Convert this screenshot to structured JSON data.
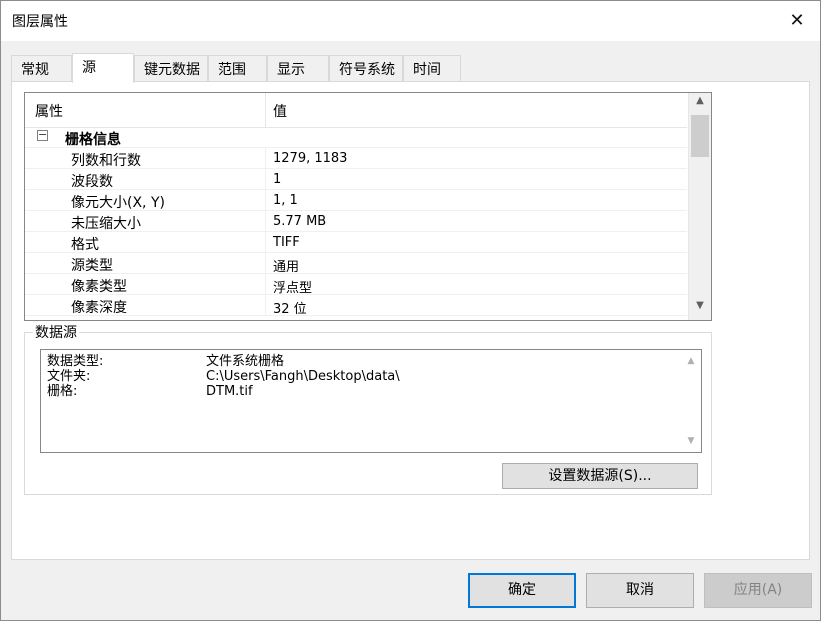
{
  "window": {
    "title": "图层属性",
    "close_symbol": "✕"
  },
  "tabs": [
    {
      "label": "常规",
      "active": false
    },
    {
      "label": "源",
      "active": true
    },
    {
      "label": "键元数据",
      "active": false
    },
    {
      "label": "范围",
      "active": false
    },
    {
      "label": "显示",
      "active": false
    },
    {
      "label": "符号系统",
      "active": false
    },
    {
      "label": "时间",
      "active": false
    }
  ],
  "property_grid": {
    "header_property": "属性",
    "header_value": "值",
    "group": {
      "toggle": "⊟",
      "label": "栅格信息"
    },
    "rows": [
      {
        "name": "列数和行数",
        "value": "1279, 1183"
      },
      {
        "name": "波段数",
        "value": "1"
      },
      {
        "name": "像元大小(X, Y)",
        "value": "1, 1"
      },
      {
        "name": "未压缩大小",
        "value": "5.77 MB"
      },
      {
        "name": "格式",
        "value": "TIFF"
      },
      {
        "name": "源类型",
        "value": "通用"
      },
      {
        "name": "像素类型",
        "value": "浮点型"
      },
      {
        "name": "像素深度",
        "value": "32 位"
      }
    ]
  },
  "data_source": {
    "group_label": "数据源",
    "lines": [
      {
        "key": "数据类型:",
        "value": "文件系统栅格"
      },
      {
        "key": "文件夹:",
        "value": "C:\\Users\\Fangh\\Desktop\\data\\"
      },
      {
        "key": "栅格:",
        "value": "DTM.tif"
      }
    ],
    "set_button": "设置数据源(S)..."
  },
  "buttons": {
    "ok": "确定",
    "cancel": "取消",
    "apply": "应用(A)"
  },
  "colors": {
    "focus": "#0078d7",
    "panel_bg": "#ffffff",
    "dialog_bg": "#f0f0f0"
  }
}
